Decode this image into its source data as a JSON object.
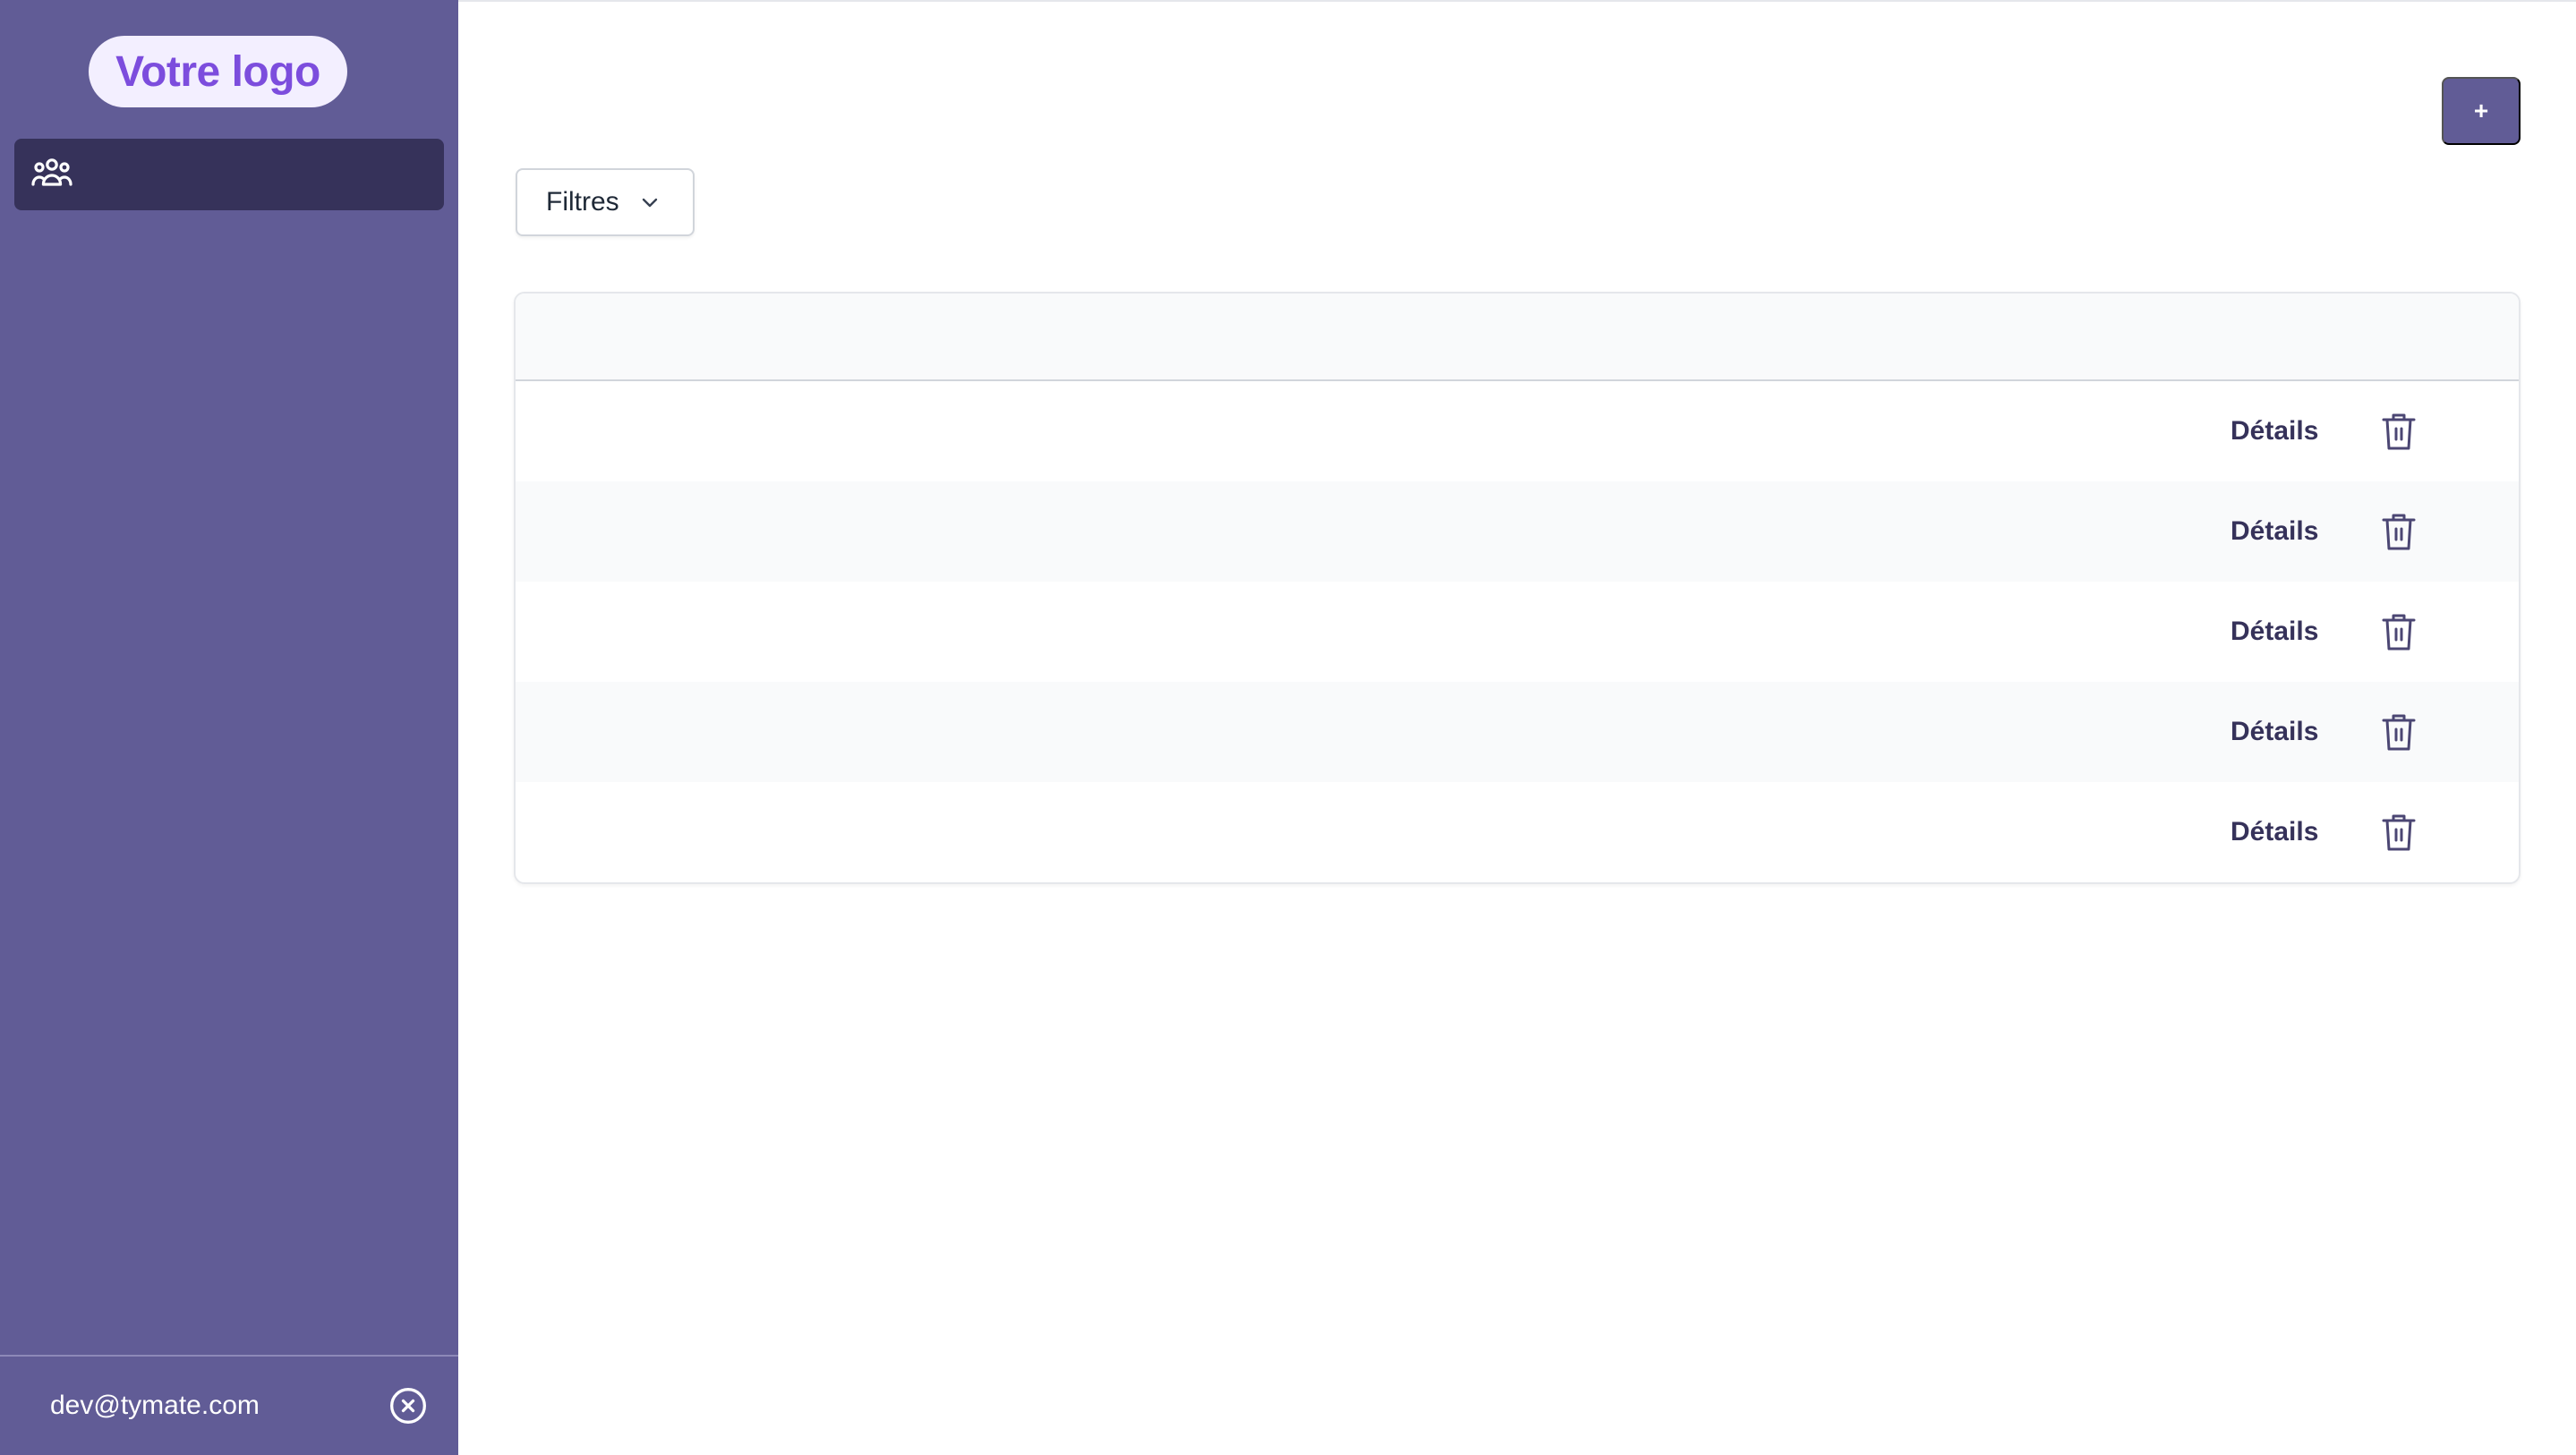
{
  "sidebar": {
    "logo_text": "Votre logo",
    "nav": [
      {
        "icon": "users-group-icon",
        "label": ""
      }
    ],
    "footer": {
      "user_email": "dev@tymate.com",
      "logout_icon": "close-circle-icon"
    }
  },
  "main": {
    "add_button_label": "+",
    "filter_button_label": "Filtres",
    "table": {
      "rows": [
        {
          "action_label": "Détails",
          "delete_icon": "trash-icon"
        },
        {
          "action_label": "Détails",
          "delete_icon": "trash-icon"
        },
        {
          "action_label": "Détails",
          "delete_icon": "trash-icon"
        },
        {
          "action_label": "Détails",
          "delete_icon": "trash-icon"
        },
        {
          "action_label": "Détails",
          "delete_icon": "trash-icon"
        }
      ]
    }
  },
  "colors": {
    "sidebar_bg": "#615c96",
    "nav_active_bg": "#36325a",
    "logo_text": "#7c4ddd",
    "accent": "#615c96"
  }
}
